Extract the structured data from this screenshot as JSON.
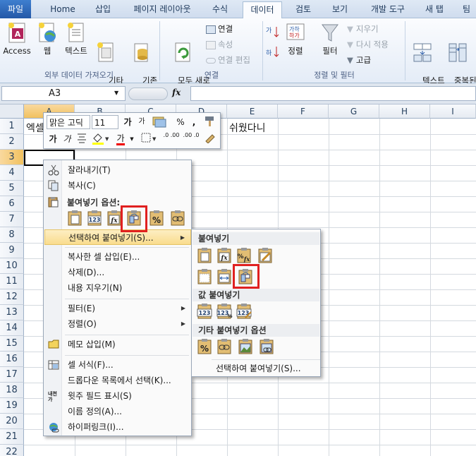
{
  "ribbon": {
    "tabs": [
      "파일",
      "Home",
      "삽입",
      "페이지 레이아웃",
      "수식",
      "데이터",
      "검토",
      "보기",
      "개발 도구",
      "새 탭",
      "팀"
    ],
    "active_tab": "데이터",
    "groups": {
      "external_data": {
        "label": "외부 데이터 가져오기",
        "buttons": [
          "Access",
          "웹",
          "텍스트",
          "기타\n원본",
          "기존\n연결"
        ]
      },
      "connections": {
        "label": "연결",
        "refresh": "모두 새로\n고침",
        "items": [
          "연결",
          "속성",
          "연결 편집"
        ]
      },
      "sort_filter": {
        "label": "정렬 및 필터",
        "sort": "정렬",
        "filter": "필터",
        "items": [
          "지우기",
          "다시 적용",
          "고급"
        ]
      },
      "tools": {
        "text_to_columns": "텍스트\n나누기",
        "remove_duplicates": "중복된\n항목 제거"
      }
    }
  },
  "formula_bar": {
    "name_box": "A3",
    "fx": "fx",
    "formula": ""
  },
  "grid": {
    "columns": [
      "A",
      "B",
      "C",
      "D",
      "E",
      "F",
      "G",
      "H",
      "I"
    ],
    "rows": [
      "1",
      "2",
      "3",
      "4",
      "5",
      "6",
      "7",
      "8",
      "9",
      "10",
      "11",
      "12",
      "13",
      "14",
      "15",
      "16",
      "17",
      "18",
      "19",
      "20",
      "21",
      "22"
    ],
    "selected_cell": "A3",
    "cells": {
      "A1": "엑셀",
      "E1": "쉬웠다니"
    }
  },
  "mini_toolbar": {
    "font": "맑은 고딕",
    "size": "11",
    "grow_font": "가",
    "shrink_font": "가",
    "percent": "%",
    "comma": ",",
    "bold": "가",
    "italic": "가",
    "font_color_glyph": "가",
    "increase_decimal": ".0 .00",
    "decrease_decimal": ".00 .0"
  },
  "context_menu": {
    "items": [
      {
        "label": "잘라내기(T)",
        "icon": "scissors-icon"
      },
      {
        "label": "복사(C)",
        "icon": "copy-icon"
      },
      {
        "label": "붙여넣기 옵션:",
        "icon": "paste-icon"
      },
      {
        "label": "선택하여 붙여넣기(S)...",
        "icon": ""
      },
      {
        "label": "복사한 셀 삽입(E)...",
        "icon": ""
      },
      {
        "label": "삭제(D)...",
        "icon": ""
      },
      {
        "label": "내용 지우기(N)",
        "icon": ""
      },
      {
        "label": "필터(E)",
        "icon": ""
      },
      {
        "label": "정렬(O)",
        "icon": ""
      },
      {
        "label": "메모 삽입(M)",
        "icon": "comment-icon"
      },
      {
        "label": "셀 서식(F)...",
        "icon": "format-cells-icon"
      },
      {
        "label": "드롭다운 목록에서 선택(K)...",
        "icon": ""
      },
      {
        "label": "윗주 필드 표시(S)",
        "icon": "phonetic-icon"
      },
      {
        "label": "이름 정의(A)...",
        "icon": ""
      },
      {
        "label": "하이퍼링크(I)...",
        "icon": "hyperlink-icon"
      }
    ],
    "paste_option_icons": [
      "paste",
      "values-123",
      "formulas-fx",
      "transpose",
      "formatting-percent",
      "paste-link"
    ],
    "phonetic_glyph": "내천\n가"
  },
  "submenu": {
    "sections": [
      {
        "title": "붙여넣기",
        "icons": [
          "paste",
          "formulas",
          "formulas-number-format",
          "keep-source-formatting",
          "no-borders",
          "keep-column-widths",
          "transpose"
        ]
      },
      {
        "title": "값 붙여넣기",
        "icons": [
          "values",
          "values-number-format",
          "values-source-formatting"
        ]
      },
      {
        "title": "기타 붙여넣기 옵션",
        "icons": [
          "formatting",
          "paste-link",
          "picture",
          "linked-picture"
        ]
      }
    ],
    "footer": "선택하여 붙여넣기(S)...",
    "glyphs": {
      "values": "123",
      "formula": "fx",
      "percent": "%"
    }
  },
  "colors": {
    "ribbon_tab": "#1e395b",
    "file_tab": "#2b6bbf",
    "menu_highlight": "#fbe3a1",
    "annotation_red": "#e02020",
    "header_selected": "#f5c96e"
  }
}
